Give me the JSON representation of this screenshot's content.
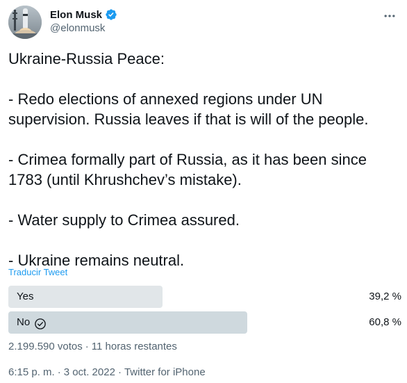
{
  "author": {
    "name": "Elon Musk",
    "handle": "@elonmusk",
    "verified_icon": "verified-badge-icon",
    "avatar_icon": "rocket-launch-avatar"
  },
  "menu": {
    "more_icon": "more-horizontal-icon"
  },
  "tweet": {
    "text": "Ukraine-Russia Peace:\n\n- Redo elections of annexed regions under UN supervision. Russia leaves if that is will of the people.\n\n- Crimea formally part of Russia, as it has been since 1783 (until Khrushchev’s mistake).\n\n- Water supply to Crimea assured.\n\n- Ukraine remains neutral.",
    "translate_label": "Traducir Tweet"
  },
  "poll": {
    "options": [
      {
        "label": "Yes",
        "percent_text": "39,2 %",
        "percent": 39.2,
        "selected": false
      },
      {
        "label": "No",
        "percent_text": "60,8 %",
        "percent": 60.8,
        "selected": true
      }
    ],
    "votes": "2.199.590 votos",
    "separator": "·",
    "remaining": "11 horas restantes"
  },
  "meta": {
    "time": "6:15 p. m.",
    "separator": "·",
    "date": "3 oct. 2022",
    "source": "Twitter for iPhone"
  },
  "colors": {
    "accent": "#1d9bf0",
    "bar_winner": "#cfd9de",
    "bar_other": "#e1e6e9",
    "secondary_text": "#536471"
  }
}
